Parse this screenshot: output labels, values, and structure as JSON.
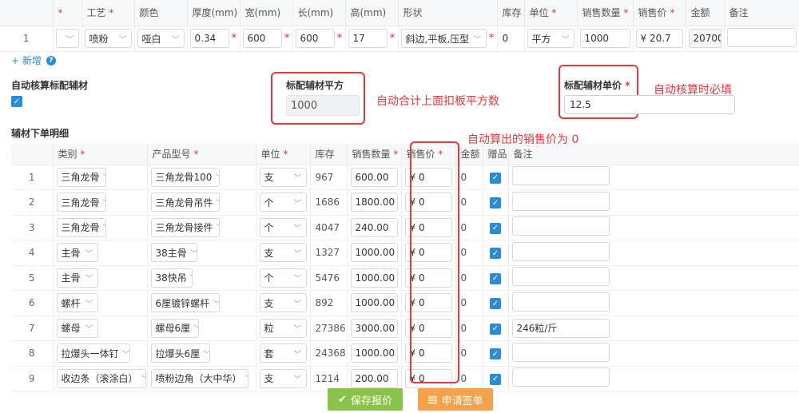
{
  "top_table": {
    "headers": {
      "col0": "",
      "col1_req": "*",
      "process": "工艺",
      "color": "颜色",
      "thickness": "厚度(mm)",
      "width": "宽(mm)",
      "length": "长(mm)",
      "height": "高(mm)",
      "shape": "形状",
      "stock": "库存",
      "unit": "单位",
      "sales_qty": "销售数量",
      "sale_price": "销售价",
      "amount": "金额",
      "remark": "备注"
    },
    "required_mark": "*",
    "row": {
      "index": "1",
      "col1": "",
      "process": "喷粉",
      "color": "哑白",
      "thickness": "0.34",
      "width": "600",
      "length": "600",
      "height": "17",
      "shape": "斜边,平板,压型",
      "stock": "0",
      "unit": "平方",
      "sales_qty": "1000",
      "sale_price": "¥ 20.7",
      "amount": "20700",
      "remark": ""
    }
  },
  "add_link": {
    "label": "+ 新增",
    "help": "?"
  },
  "auto_calc": {
    "label": "自动核算标配辅材",
    "checked": true
  },
  "std_area": {
    "label": "标配辅材平方",
    "value": "1000",
    "annotation": "自动合计上面扣板平方数"
  },
  "std_price": {
    "label": "标配辅材单价",
    "required": "*",
    "value": "12.5",
    "annotation": "自动核算时必填"
  },
  "acc_section": {
    "title": "辅材下单明细",
    "price_annotation": "自动算出的销售价为 0"
  },
  "acc_table": {
    "headers": {
      "idx": "",
      "category": "类别",
      "model": "产品型号",
      "unit": "单位",
      "stock": "库存",
      "sales_qty": "销售数量",
      "sale_price": "销售价",
      "amount": "金额",
      "gift": "赠品",
      "remark": "备注"
    },
    "rows": [
      {
        "index": "1",
        "category": "三角龙骨",
        "model": "三角龙骨100",
        "unit": "支",
        "stock": "967",
        "qty": "600.00",
        "price": "¥ 0",
        "amount": "0",
        "gift": true,
        "remark": ""
      },
      {
        "index": "2",
        "category": "三角龙骨",
        "model": "三角龙骨吊件",
        "unit": "个",
        "stock": "1686",
        "qty": "1800.00",
        "price": "¥ 0",
        "amount": "0",
        "gift": true,
        "remark": ""
      },
      {
        "index": "3",
        "category": "三角龙骨",
        "model": "三角龙骨接件",
        "unit": "个",
        "stock": "4047",
        "qty": "240.00",
        "price": "¥ 0",
        "amount": "0",
        "gift": true,
        "remark": ""
      },
      {
        "index": "4",
        "category": "主骨",
        "model": "38主骨",
        "unit": "支",
        "stock": "1327",
        "qty": "1000.00",
        "price": "¥ 0",
        "amount": "0",
        "gift": true,
        "remark": ""
      },
      {
        "index": "5",
        "category": "主骨",
        "model": "38快吊",
        "unit": "个",
        "stock": "5476",
        "qty": "1000.00",
        "price": "¥ 0",
        "amount": "0",
        "gift": true,
        "remark": ""
      },
      {
        "index": "6",
        "category": "螺杆",
        "model": "6厘镀锌螺杆",
        "unit": "支",
        "stock": "892",
        "qty": "1000.00",
        "price": "¥ 0",
        "amount": "0",
        "gift": true,
        "remark": ""
      },
      {
        "index": "7",
        "category": "螺母",
        "model": "螺母6厘",
        "unit": "粒",
        "stock": "27386",
        "qty": "3000.00",
        "price": "¥ 0",
        "amount": "0",
        "gift": true,
        "remark": "246粒/斤"
      },
      {
        "index": "8",
        "category": "拉爆头一体钉",
        "model": "拉爆头6厘",
        "unit": "套",
        "stock": "24368",
        "qty": "1000.00",
        "price": "¥ 0",
        "amount": "0",
        "gift": true,
        "remark": ""
      },
      {
        "index": "9",
        "category": "收边条（滚涂白）",
        "model": "喷粉边角（大中华）",
        "unit": "支",
        "stock": "1214",
        "qty": "200.00",
        "price": "¥ 0",
        "amount": "0",
        "gift": true,
        "remark": ""
      }
    ]
  },
  "buttons": {
    "save": {
      "label": "保存报价",
      "color": "#8bc34a"
    },
    "submit": {
      "label": "申请签单",
      "color": "#f5a14a"
    }
  },
  "colors": {
    "accent": "#2a8bd8",
    "required": "#e4393c",
    "annotation": "#e4393c"
  }
}
